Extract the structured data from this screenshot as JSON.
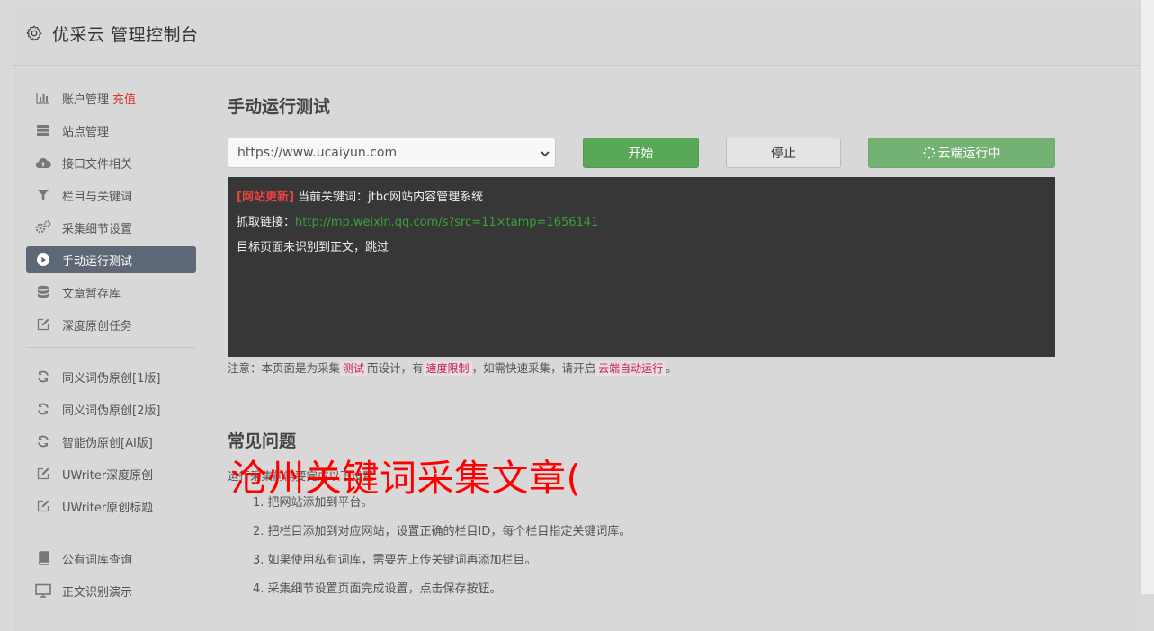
{
  "app": {
    "title": "优采云 管理控制台"
  },
  "sidebar": {
    "group1": [
      {
        "label": "账户管理",
        "badge": "充值",
        "icon": "bar-chart-icon"
      },
      {
        "label": "站点管理",
        "icon": "server-icon"
      },
      {
        "label": "接口文件相关",
        "icon": "cloud-upload-icon"
      },
      {
        "label": "栏目与关键词",
        "icon": "filter-icon"
      },
      {
        "label": "采集细节设置",
        "icon": "gears-icon"
      },
      {
        "label": "手动运行测试",
        "icon": "play-circle-icon",
        "active": true
      },
      {
        "label": "文章暂存库",
        "icon": "database-icon"
      },
      {
        "label": "深度原创任务",
        "icon": "edit-icon"
      }
    ],
    "group2": [
      {
        "label": "同义词伪原创[1版]",
        "icon": "refresh-icon"
      },
      {
        "label": "同义词伪原创[2版]",
        "icon": "refresh-icon"
      },
      {
        "label": "智能伪原创[AI版]",
        "icon": "refresh-icon"
      },
      {
        "label": "UWriter深度原创",
        "icon": "edit-icon"
      },
      {
        "label": "UWriter原创标题",
        "icon": "edit-icon"
      }
    ],
    "group3": [
      {
        "label": "公有词库查询",
        "icon": "book-icon"
      },
      {
        "label": "正文识别演示",
        "icon": "monitor-icon"
      }
    ]
  },
  "main": {
    "title": "手动运行测试",
    "site_select": {
      "value": "https://www.ucaiyun.com"
    },
    "buttons": {
      "start": "开始",
      "stop": "停止",
      "cloud": "云端运行中"
    },
    "console": {
      "tag": "[网站更新]",
      "line1": "当前关键词：jtbc网站内容管理系统",
      "line2_label": "抓取链接：",
      "line2_link": "http://mp.weixin.qq.com/s?src=11×tamp=1656141",
      "line3": "目标页面未识别到正文，跳过"
    },
    "note": {
      "p1": "注意：本页面是为采集",
      "c1": "测试",
      "p2": "而设计，有",
      "c2": "速度限制",
      "p3": "，如需快速采集，请开启",
      "c3": "云端自动运行",
      "p4": "。"
    },
    "faq": {
      "title": "常见问题",
      "subtitle": "运行采集前需要完成以下设置",
      "items": [
        "1. 把网站添加到平台。",
        "2. 把栏目添加到对应网站，设置正确的栏目ID，每个栏目指定关键词库。",
        "3. 如果使用私有词库，需要先上传关键词再添加栏目。",
        "4. 采集细节设置页面完成设置，点击保存按钮。"
      ]
    },
    "overlay_text": "沧州关键词采集文章("
  },
  "colors": {
    "accent_green": "#58a858",
    "active_nav": "#5d6775",
    "console_bg": "#373737",
    "overlay_red": "#ff0000"
  }
}
